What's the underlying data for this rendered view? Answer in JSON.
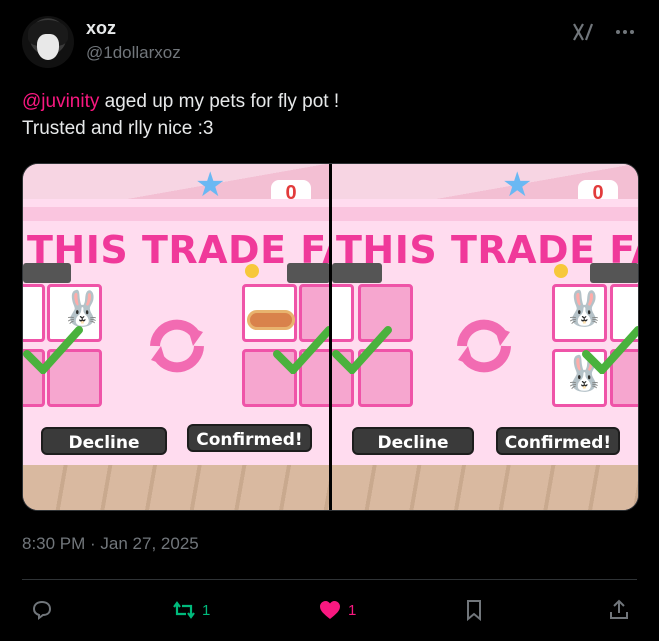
{
  "tweet": {
    "display_name": "xoz",
    "handle": "@1dollarxoz",
    "mention": "@juvinity",
    "text_line1_rest": " aged up my pets for fly pot !",
    "text_line2": "Trusted and rlly nice :3",
    "timestamp": "8:30 PM · Jan 27, 2025"
  },
  "media": {
    "left": {
      "counter": "0",
      "banner": "THIS TRADE FAI",
      "decline_label": "Decline",
      "confirm_label": "Confirmed!"
    },
    "right": {
      "counter": "0",
      "banner": "THIS TRADE FAI",
      "decline_label": "Decline",
      "confirm_label": "Confirmed!"
    }
  },
  "actions": {
    "reply_count": "",
    "retweet_count": "1",
    "like_count": "1"
  },
  "colors": {
    "mention": "#f91880",
    "retweet": "#00ba7c",
    "like": "#f91880",
    "muted": "#71767b"
  },
  "icons": [
    "grok-icon",
    "more-icon",
    "reply-icon",
    "retweet-icon",
    "like-icon",
    "bookmark-icon",
    "share-icon"
  ]
}
